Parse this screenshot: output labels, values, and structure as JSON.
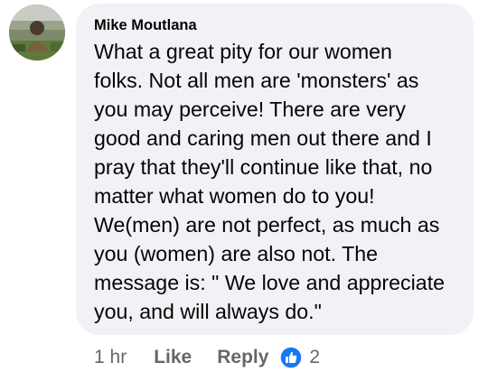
{
  "comment": {
    "author": "Mike Moutlana",
    "text_lines": [
      "What a great pity for our women",
      "folks. Not all men are 'monsters' as",
      "you may perceive! There are very",
      "good and caring men out there and I",
      "pray that they'll continue like that, no",
      "matter what women do to you!",
      "We(men) are not perfect, as much as",
      "you (women) are also not. The",
      "message is: \" We love and appreciate",
      "you, and will always do.\""
    ],
    "timestamp": "1 hr",
    "like_label": "Like",
    "reply_label": "Reply",
    "reaction_icon": "like-icon",
    "reaction_count": "2"
  },
  "colors": {
    "bubble_bg": "#f0f2f5",
    "text": "#050505",
    "meta_text": "#65676b",
    "like_blue": "#1877f2"
  }
}
